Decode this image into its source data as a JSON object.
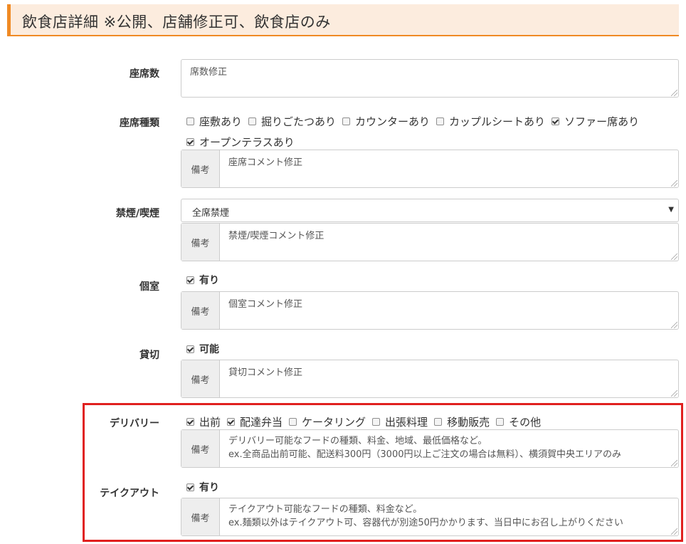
{
  "header": {
    "title": "飲食店詳細 ※公開、店舗修正可、飲食店のみ"
  },
  "seats_count": {
    "label": "座席数",
    "value": "席数修正"
  },
  "seat_types": {
    "label": "座席種類",
    "options": [
      {
        "label": "座敷あり",
        "checked": false
      },
      {
        "label": "掘りごたつあり",
        "checked": false
      },
      {
        "label": "カウンターあり",
        "checked": false
      },
      {
        "label": "カップルシートあり",
        "checked": false
      },
      {
        "label": "ソファー席あり",
        "checked": true
      },
      {
        "label": "オープンテラスあり",
        "checked": true
      }
    ],
    "note_label": "備考",
    "note": "座席コメント修正"
  },
  "smoking": {
    "label": "禁煙/喫煙",
    "selected": "全席禁煙",
    "note_label": "備考",
    "note": "禁煙/喫煙コメント修正"
  },
  "private_room": {
    "label": "個室",
    "option": {
      "label": "有り",
      "checked": true
    },
    "note_label": "備考",
    "note": "個室コメント修正"
  },
  "reserved": {
    "label": "貸切",
    "option": {
      "label": "可能",
      "checked": true
    },
    "note_label": "備考",
    "note": "貸切コメント修正"
  },
  "delivery": {
    "label": "デリバリー",
    "options": [
      {
        "label": "出前",
        "checked": true
      },
      {
        "label": "配達弁当",
        "checked": true
      },
      {
        "label": "ケータリング",
        "checked": false
      },
      {
        "label": "出張料理",
        "checked": false
      },
      {
        "label": "移動販売",
        "checked": false
      },
      {
        "label": "その他",
        "checked": false
      }
    ],
    "note_label": "備考",
    "note_line1": "デリバリー可能なフードの種類、料金、地域、最低価格など。",
    "note_line2": "ex.全商品出前可能、配送料300円（3000円以上ご注文の場合は無料）、横須賀中央エリアのみ"
  },
  "takeout": {
    "label": "テイクアウト",
    "option": {
      "label": "有り",
      "checked": true
    },
    "note_label": "備考",
    "note_line1": "テイクアウト可能なフードの種類、料金など。",
    "note_line2": "ex.麺類以外はテイクアウト可、容器代が別途50円かかります、当日中にお召し上がりください"
  },
  "colors": {
    "accent": "#f08a24",
    "header_bg": "#fcecde",
    "highlight": "#e0201f"
  }
}
